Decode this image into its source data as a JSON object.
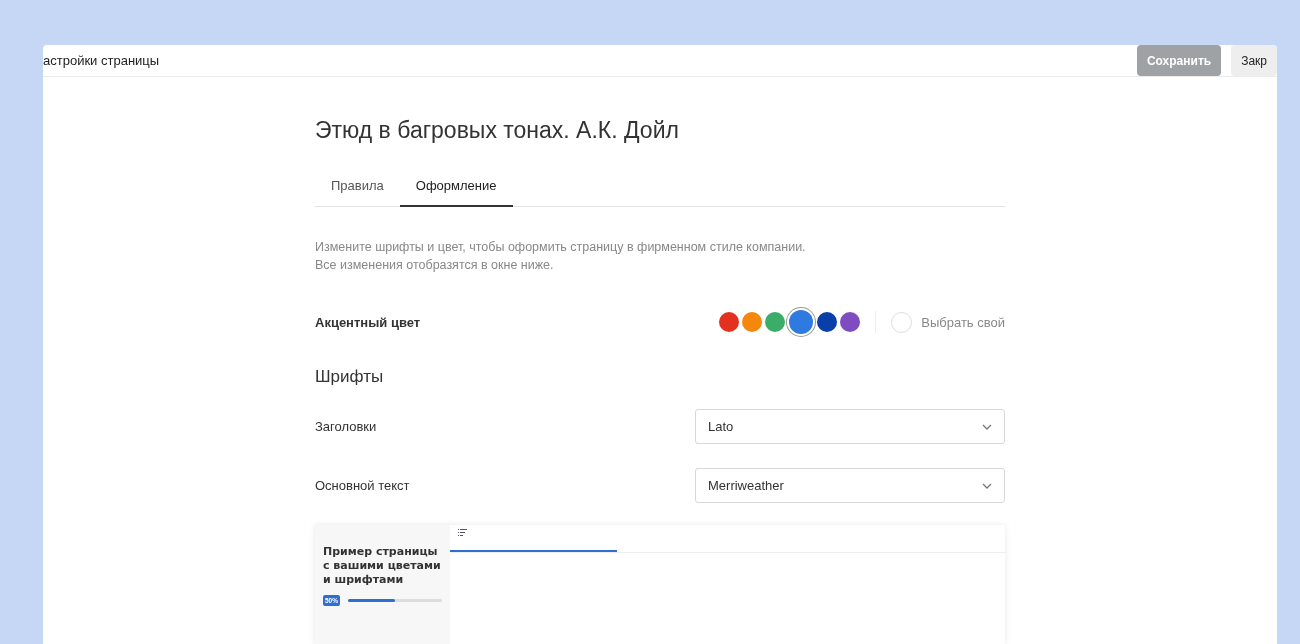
{
  "header": {
    "title": "астройки страницы",
    "buttons": [
      {
        "label": "Сохранить",
        "disabled": true
      },
      {
        "label": "Закр",
        "disabled": false
      }
    ]
  },
  "page_title": "Этюд в багровых тонах. А.К. Дойл",
  "tabs": [
    {
      "label": "Правила",
      "selected": false
    },
    {
      "label": "Оформление",
      "selected": true
    }
  ],
  "description": [
    "Измените шрифты и цвет, чтобы оформить страницу в фирменном стиле компании.",
    "Все изменения отобразятся в окне ниже."
  ],
  "accent": {
    "label": "Акцентный цвет",
    "colors": [
      {
        "color": "#e3311f",
        "selected": false
      },
      {
        "color": "#f5870c",
        "selected": false
      },
      {
        "color": "#3aad69",
        "selected": false
      },
      {
        "color": "#2f7ae0",
        "selected": true
      },
      {
        "color": "#0a3ea8",
        "selected": false
      },
      {
        "color": "#7e4cc0",
        "selected": false
      }
    ],
    "custom_label": "Выбрать свой"
  },
  "fonts": {
    "title": "Шрифты",
    "rows": [
      {
        "label": "Заголовки",
        "value": "Lato"
      },
      {
        "label": "Основной текст",
        "value": "Merriweather"
      }
    ]
  },
  "preview": {
    "card_title": "Пример страницы с вашими цветами и шрифтами",
    "progress_label": "50%",
    "level": 0.5,
    "reading_bar": {
      "level": 0.3
    }
  }
}
